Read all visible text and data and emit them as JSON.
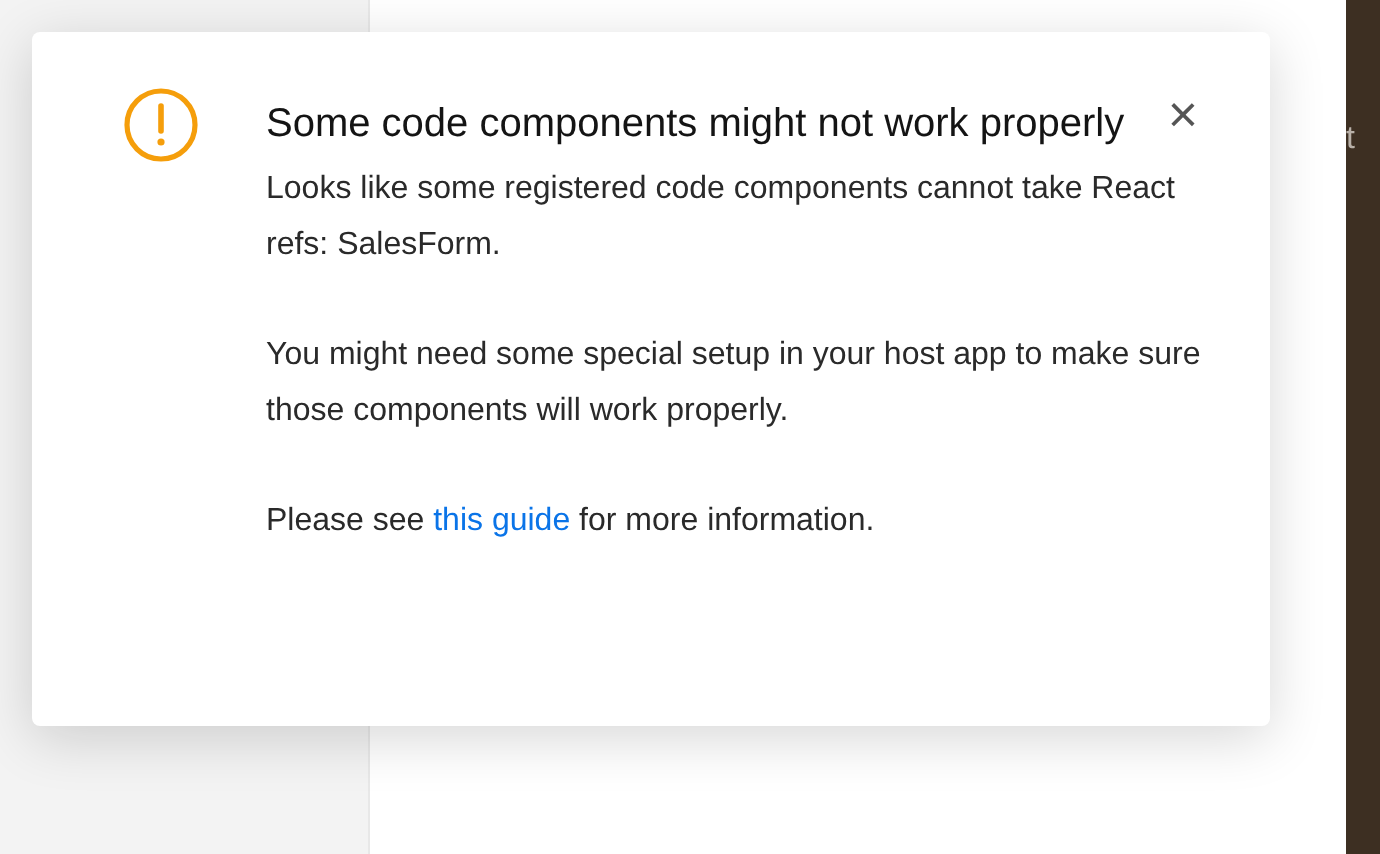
{
  "background": {
    "edge_text": "t"
  },
  "dialog": {
    "title": "Some code components might not work properly",
    "paragraphs": [
      {
        "kind": "text",
        "text": "Looks like some registered code components cannot take React refs: SalesForm."
      },
      {
        "kind": "text",
        "text": "You might need some special setup in your host app to make sure those components will work properly."
      },
      {
        "kind": "link_text",
        "before": "Please see ",
        "link": "this guide",
        "after": " for more information."
      }
    ],
    "close": "×"
  }
}
